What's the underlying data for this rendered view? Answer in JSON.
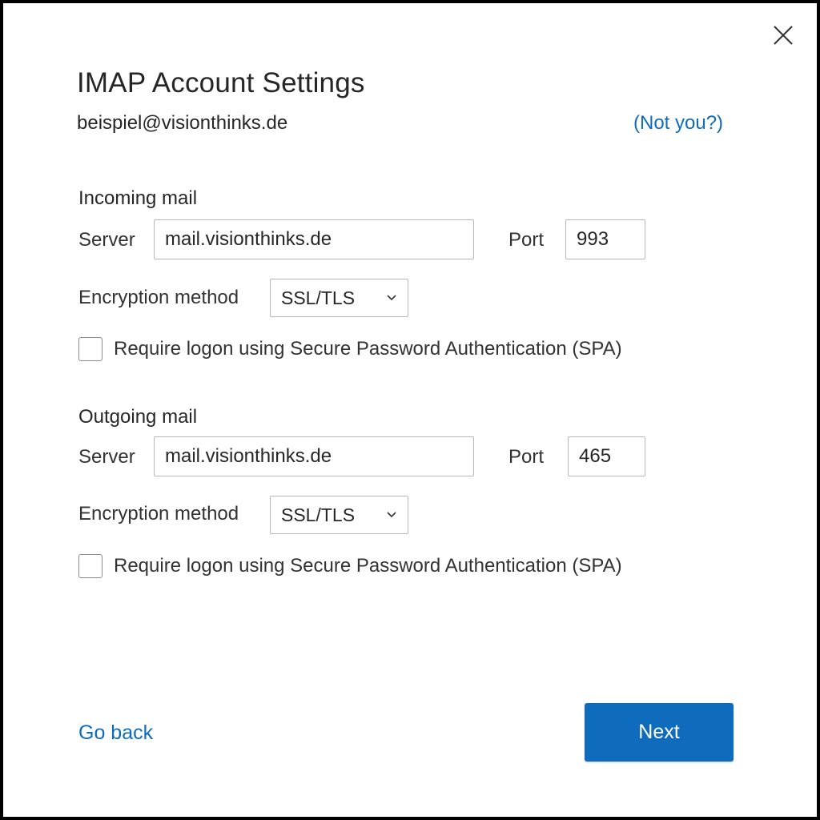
{
  "dialog": {
    "title": "IMAP Account Settings",
    "email": "beispiel@visionthinks.de",
    "not_you": "(Not you?)",
    "close_icon": "close-icon"
  },
  "incoming": {
    "section_label": "Incoming mail",
    "server_label": "Server",
    "server_value": "mail.visionthinks.de",
    "port_label": "Port",
    "port_value": "993",
    "encryption_label": "Encryption method",
    "encryption_value": "SSL/TLS",
    "spa_label": "Require logon using Secure Password Authentication (SPA)",
    "spa_checked": false
  },
  "outgoing": {
    "section_label": "Outgoing mail",
    "server_label": "Server",
    "server_value": "mail.visionthinks.de",
    "port_label": "Port",
    "port_value": "465",
    "encryption_label": "Encryption method",
    "encryption_value": "SSL/TLS",
    "spa_label": "Require logon using Secure Password Authentication (SPA)",
    "spa_checked": false
  },
  "footer": {
    "go_back": "Go back",
    "next": "Next"
  },
  "colors": {
    "accent": "#0f6cbd",
    "text": "#262626",
    "border": "#b7b7b7"
  }
}
